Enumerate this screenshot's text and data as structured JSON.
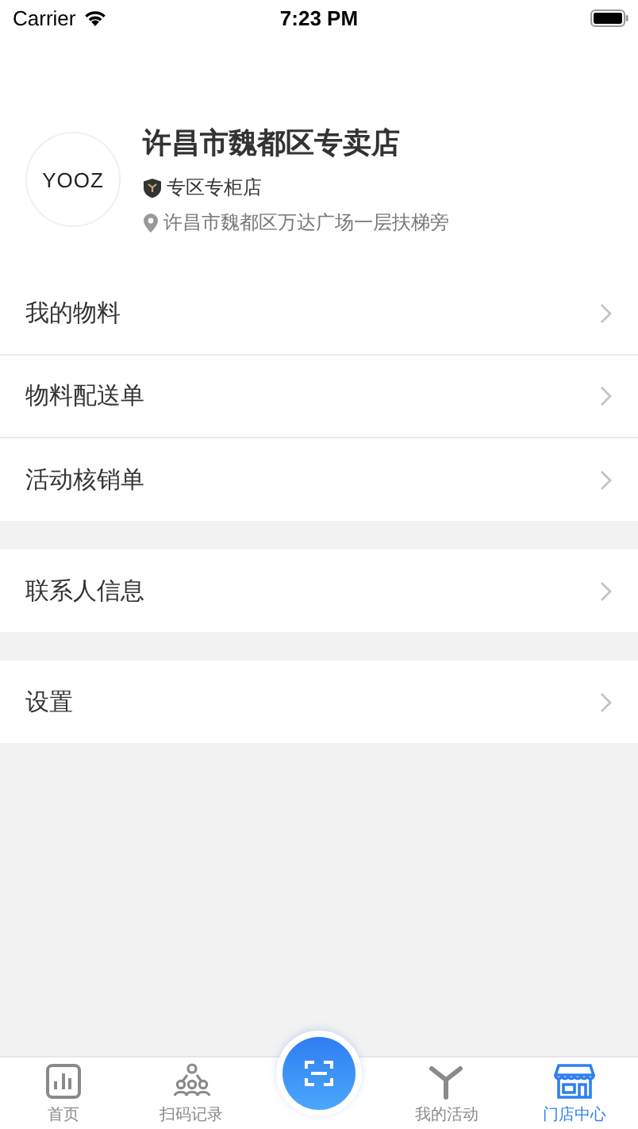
{
  "status_bar": {
    "carrier": "Carrier",
    "time": "7:23 PM"
  },
  "store": {
    "logo": "YOOZ",
    "name": "许昌市魏都区专卖店",
    "type": "专区专柜店",
    "address": "许昌市魏都区万达广场一层扶梯旁"
  },
  "menu_groups": [
    {
      "items": [
        "我的物料",
        "物料配送单",
        "活动核销单"
      ]
    },
    {
      "items": [
        "联系人信息"
      ]
    },
    {
      "items": [
        "设置"
      ]
    }
  ],
  "tabs": [
    {
      "kind": "home",
      "label": "首页",
      "selected": false
    },
    {
      "kind": "records",
      "label": "扫码记录",
      "selected": false
    },
    {
      "kind": "scan",
      "selected": false
    },
    {
      "kind": "activity",
      "label": "我的活动",
      "selected": false
    },
    {
      "kind": "store",
      "label": "门店中心",
      "selected": true
    }
  ]
}
